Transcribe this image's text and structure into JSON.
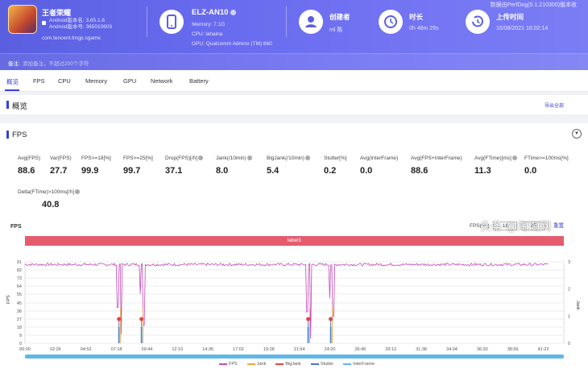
{
  "header": {
    "toolbar_note": "数据由PerfDog(5.1.210300)版本收",
    "app": {
      "name": "王者荣耀",
      "android_version": "Android版本名: 3.65.1.6",
      "android_code": "Android版本号: 365010603",
      "package": "com.tencent.tmgp.sgame"
    },
    "device": {
      "name": "ELZ-AN10",
      "memory": "Memory: 7.1G",
      "cpu": "CPU: lahaina",
      "gpu": "GPU: Qualcomm Adreno (TM) 660"
    },
    "creator": {
      "label": "创建者",
      "value": "ml 陈"
    },
    "duration": {
      "label": "时长",
      "value": "0h 48m 29s"
    },
    "upload": {
      "label": "上传时间",
      "value": "16/08/2021 16:02:14"
    },
    "note": {
      "label": "备注:",
      "placeholder": "添加备注，不超过200个字符"
    }
  },
  "tabs": [
    "概览",
    "FPS",
    "CPU",
    "Memory",
    "GPU",
    "Network",
    "Battery"
  ],
  "overview": {
    "title": "概览",
    "export": "导出全部"
  },
  "fps": {
    "title": "FPS",
    "stats": [
      {
        "label": "Avg(FPS)",
        "value": "88.6"
      },
      {
        "label": "Var(FPS)",
        "value": "27.7"
      },
      {
        "label": "FPS>=18[%]",
        "value": "99.9"
      },
      {
        "label": "FPS>=25[%]",
        "value": "99.7"
      },
      {
        "label": "Drop(FPS)[/h]",
        "value": "37.1"
      },
      {
        "label": "Jank(/10min)",
        "value": "8.0"
      },
      {
        "label": "BigJank(/10min)",
        "value": "5.4"
      },
      {
        "label": "Stutter[%]",
        "value": "0.2"
      },
      {
        "label": "Avg(InterFrame)",
        "value": "0.0"
      },
      {
        "label": "Avg(FPS+InterFrame)",
        "value": "88.6"
      },
      {
        "label": "Avg(FTime)[ms]",
        "value": "11.3"
      },
      {
        "label": "FTime>=100ms[%]",
        "value": "0.0"
      },
      {
        "label": "Delta(FTime)>100ms[/h]",
        "value": "40.8"
      }
    ],
    "chart_label": "FPS",
    "threshold_label": "FPS(>=)",
    "threshold_a": "18",
    "threshold_b": "25",
    "reset": "重置",
    "label_bar": "label1"
  },
  "chart_data": {
    "type": "line",
    "ylabel": "FPS",
    "y2label": "Jank",
    "ylim": [
      0,
      91
    ],
    "y_ticks": [
      "91",
      "82",
      "73",
      "64",
      "55",
      "45",
      "36",
      "27",
      "18",
      "9",
      "0"
    ],
    "y2_ticks": [
      "3",
      "2",
      "1",
      "0"
    ],
    "x_ticks": [
      "00:00",
      "02:26",
      "04:52",
      "07:18",
      "09:44",
      "12:10",
      "14:36",
      "17:02",
      "19:28",
      "21:54",
      "24:20",
      "26:46",
      "29:12",
      "31:38",
      "34:04",
      "36:30",
      "38:56",
      "41:22"
    ],
    "series": [
      {
        "name": "FPS",
        "color": "#c44ab8"
      },
      {
        "name": "Jank",
        "color": "#f0a340"
      },
      {
        "name": "BigJank",
        "color": "#e0453f"
      },
      {
        "name": "Stutter",
        "color": "#4a78c8"
      },
      {
        "name": "InterFrame",
        "color": "#5fb7e8"
      }
    ],
    "fps_baseline": 88,
    "fps_drops": [
      {
        "t": 7.4,
        "v": 40
      },
      {
        "t": 7.7,
        "v": 10
      },
      {
        "t": 9.2,
        "v": 55
      },
      {
        "t": 9.5,
        "v": 20
      },
      {
        "t": 22.5,
        "v": 35
      },
      {
        "t": 22.8,
        "v": 5
      },
      {
        "t": 24.3,
        "v": 50
      },
      {
        "t": 24.6,
        "v": 30
      }
    ],
    "bigjank_points": [
      7.5,
      9.3,
      22.6,
      24.4
    ],
    "legend_position": "bottom"
  },
  "watermark": "头条 @淘淘网"
}
